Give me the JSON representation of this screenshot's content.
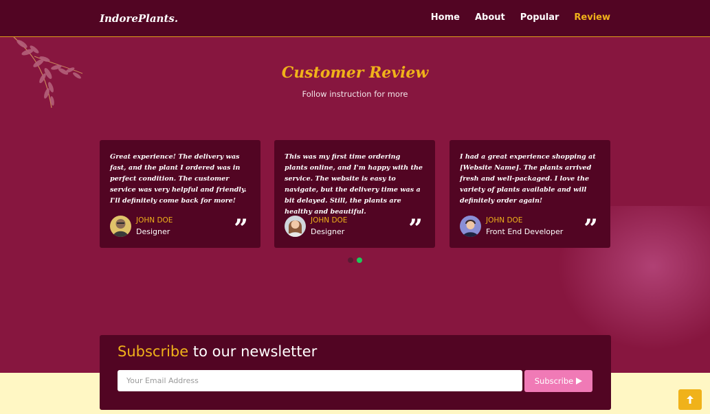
{
  "nav": {
    "logo": "IndorePlants.",
    "links": [
      {
        "label": "Home"
      },
      {
        "label": "About"
      },
      {
        "label": "Popular"
      },
      {
        "label": "Review"
      }
    ]
  },
  "review": {
    "title": "Customer Review",
    "subtitle": "Follow instruction for more",
    "cards": [
      {
        "text": "Great experience! The delivery was fast, and the plant I ordered was in perfect condition. The customer service was very helpful and friendly. I'll definitely come back for more!",
        "name": "JOHN DOE",
        "role": "Designer",
        "quote": "”"
      },
      {
        "text": "This was my first time ordering plants online, and I'm happy with the service. The website is easy to navigate, but the delivery time was a bit delayed. Still, the plants are healthy and beautiful.",
        "name": "JOHN DOE",
        "role": "Designer",
        "quote": "”"
      },
      {
        "text": "I had a great experience shopping at [Website Name]. The plants arrived fresh and well-packaged. I love the variety of plants available and will definitely order again!",
        "name": "JOHN DOE",
        "role": "Front End Developer",
        "quote": "”"
      }
    ]
  },
  "newsletter": {
    "title_accent": "Subscribe",
    "title_rest": " to our newsletter",
    "placeholder": "Your Email Address",
    "button_label": "Subscribe"
  },
  "colors": {
    "background": "#87163f",
    "panel": "#520523",
    "accent": "#f0b21a",
    "button": "#f07ab6",
    "footer": "#fff7c4"
  }
}
